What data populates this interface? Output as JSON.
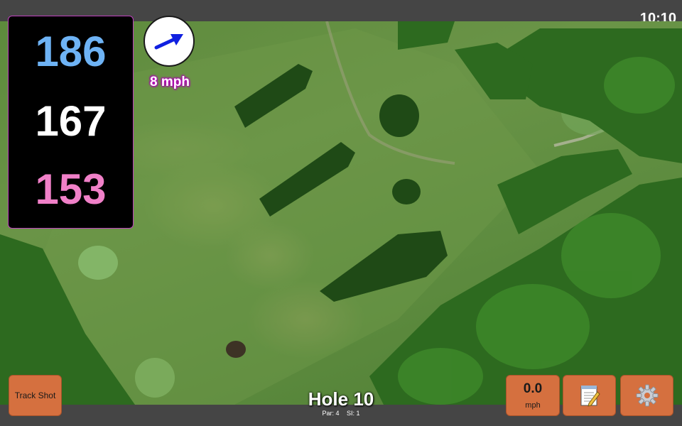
{
  "status_bar": {
    "time": "10:10"
  },
  "yardages": {
    "back": "186",
    "middle": "167",
    "front": "153"
  },
  "wind": {
    "speed": "8 mph",
    "direction_icon": "arrow-icon"
  },
  "buttons": {
    "track_shot": "Track Shot",
    "speed_value": "0.0",
    "speed_unit": "mph",
    "notes_icon": "notepad-icon",
    "settings_icon": "gear-icon"
  },
  "hole": {
    "title": "Hole 10",
    "par": "Par: 4",
    "si": "SI: 1"
  },
  "colors": {
    "back_yardage": "#6eb3f5",
    "middle_yardage": "#ffffff",
    "front_yardage": "#f080c8",
    "button_orange": "#d5703f",
    "bar_gray": "#454545"
  }
}
